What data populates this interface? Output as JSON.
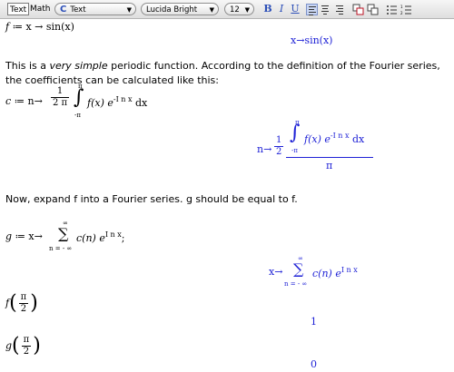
{
  "toolbar": {
    "mode_text": "Text",
    "mode_math": "Math",
    "style_icon": "C",
    "style_value": "Text",
    "font_value": "Lucida Bright",
    "size_value": "12",
    "bold": "B",
    "italic": "I",
    "underline": "U"
  },
  "doc": {
    "line1": {
      "lhs": "f",
      "assign": "≔",
      "var": "x",
      "arrow": "→",
      "rhs": "sin(x)"
    },
    "out1": "x→sin(x)",
    "para1_a": "This is a ",
    "para1_em": "very simple",
    "para1_b": " periodic function. According to the definition of the Fourier series, the coefficients can be calculated like this:",
    "line2": {
      "lhs": "c",
      "assign": "≔",
      "var": "n",
      "arrow": "→",
      "num": "1",
      "den": "2 π",
      "upper": "π",
      "lower": "-π",
      "body": "f(x) e",
      "exp": "-I n x",
      "dx": "dx"
    },
    "out2": {
      "var": "n",
      "arrow": "→",
      "num": "1",
      "den": "2",
      "upper": "π",
      "lower": "-π",
      "body": "f(x) e",
      "exp": "-I n x",
      "dx": "dx",
      "denom": "π"
    },
    "para2": "Now, expand f into a Fourier series. g should be equal to f.",
    "line3": {
      "lhs": "g",
      "assign": "≔",
      "var": "x",
      "arrow": "→",
      "upper": "∞",
      "lower": "n = - ∞",
      "body": "c(n) e",
      "exp": "I n x",
      "end": ";"
    },
    "out3": {
      "var": "x",
      "arrow": "→",
      "upper": "∞",
      "lower": "n = - ∞",
      "body": "c(n) e",
      "exp": "I n x"
    },
    "q1": {
      "fn": "f",
      "num": "π",
      "den": "2"
    },
    "a1": "1",
    "q2": {
      "fn": "g",
      "num": "π",
      "den": "2"
    },
    "a2": "0"
  }
}
